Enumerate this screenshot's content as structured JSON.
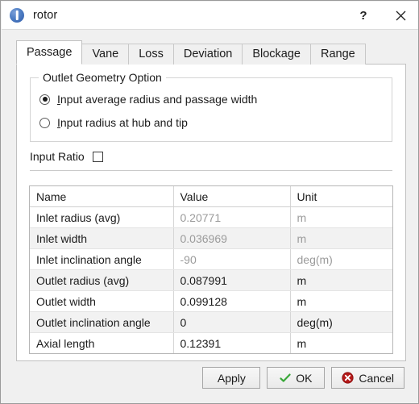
{
  "window": {
    "title": "rotor",
    "icon": "info-circle-icon",
    "help_label": "?",
    "close_label": "✕"
  },
  "tabs": [
    {
      "label": "Passage",
      "active": true
    },
    {
      "label": "Vane",
      "active": false
    },
    {
      "label": "Loss",
      "active": false
    },
    {
      "label": "Deviation",
      "active": false
    },
    {
      "label": "Blockage",
      "active": false
    },
    {
      "label": "Range",
      "active": false
    }
  ],
  "group": {
    "title": "Outlet Geometry Option",
    "options": [
      {
        "prefix": "I",
        "label": "nput average radius and passage width",
        "selected": true
      },
      {
        "prefix": "I",
        "label": "nput radius at hub and tip",
        "selected": false
      }
    ]
  },
  "ratio": {
    "label": "Input Ratio",
    "checked": false
  },
  "table": {
    "headers": [
      "Name",
      "Value",
      "Unit"
    ],
    "rows": [
      {
        "name": "Inlet radius (avg)",
        "value": "0.20771",
        "unit": "m",
        "disabled": true,
        "alt": false
      },
      {
        "name": "Inlet width",
        "value": "0.036969",
        "unit": "m",
        "disabled": true,
        "alt": true
      },
      {
        "name": "Inlet inclination angle",
        "value": "-90",
        "unit": "deg(m)",
        "disabled": true,
        "alt": false
      },
      {
        "name": "Outlet radius (avg)",
        "value": "0.087991",
        "unit": "m",
        "disabled": false,
        "alt": true
      },
      {
        "name": "Outlet width",
        "value": "0.099128",
        "unit": "m",
        "disabled": false,
        "alt": false
      },
      {
        "name": "Outlet inclination angle",
        "value": "0",
        "unit": "deg(m)",
        "disabled": false,
        "alt": true
      },
      {
        "name": "Axial length",
        "value": "0.12391",
        "unit": "m",
        "disabled": false,
        "alt": false
      }
    ]
  },
  "footer": {
    "apply_label": "Apply",
    "ok_label": "OK",
    "cancel_label": "Cancel"
  },
  "colors": {
    "accent_blue": "#2f5ba8",
    "ok_green": "#3aa83a",
    "cancel_red": "#b51a1a",
    "disabled_text": "#9b9b9b",
    "alt_row": "#f2f2f2"
  }
}
